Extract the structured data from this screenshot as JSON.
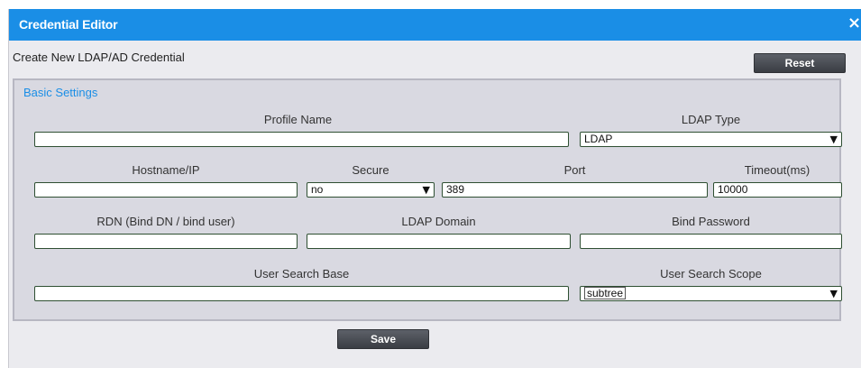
{
  "window": {
    "title": "Credential Editor",
    "close_glyph": "×"
  },
  "header": {
    "subtitle": "Create New LDAP/AD Credential",
    "reset_label": "Reset"
  },
  "section": {
    "legend": "Basic Settings"
  },
  "fields": {
    "profile_name": {
      "label": "Profile Name",
      "value": ""
    },
    "ldap_type": {
      "label": "LDAP Type",
      "value": "LDAP"
    },
    "hostname": {
      "label": "Hostname/IP",
      "value": ""
    },
    "secure": {
      "label": "Secure",
      "value": "no"
    },
    "port": {
      "label": "Port",
      "value": "389"
    },
    "timeout": {
      "label": "Timeout(ms)",
      "value": "10000"
    },
    "rdn": {
      "label": "RDN (Bind DN / bind user)",
      "value": ""
    },
    "ldap_domain": {
      "label": "LDAP Domain",
      "value": ""
    },
    "bind_password": {
      "label": "Bind Password",
      "value": ""
    },
    "user_search_base": {
      "label": "User Search Base",
      "value": ""
    },
    "user_search_scope": {
      "label": "User Search Scope",
      "value": "subtree"
    }
  },
  "footer": {
    "save_label": "Save"
  },
  "icons": {
    "dropdown": "chevron-down-icon",
    "close": "close-icon"
  },
  "colors": {
    "accent": "#1a8ee6",
    "button": "#44474d",
    "field_border": "#2e4f32"
  }
}
